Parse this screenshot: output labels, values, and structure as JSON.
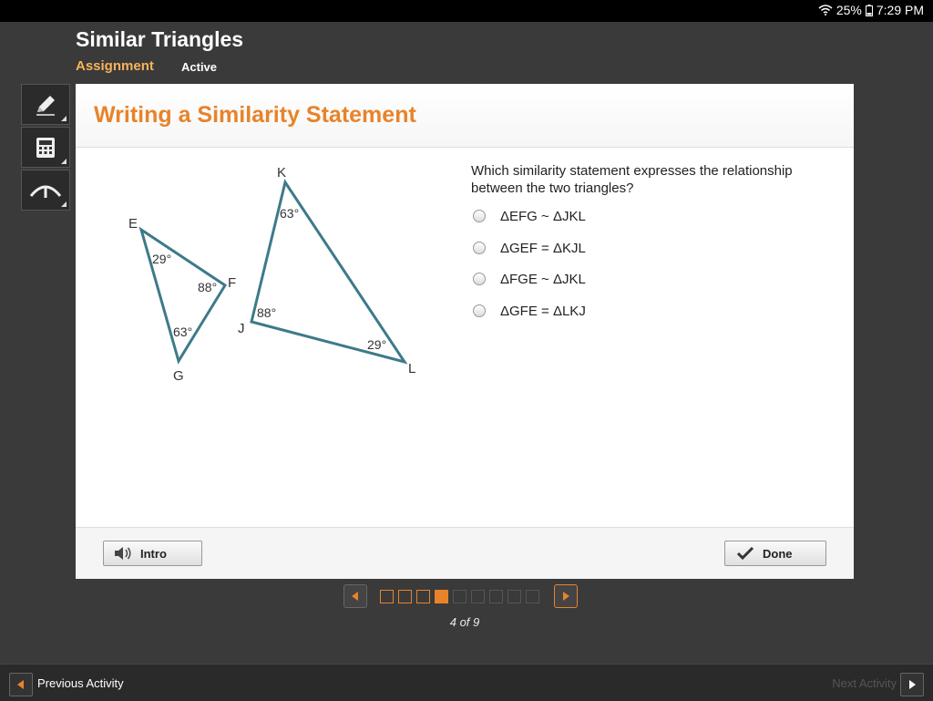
{
  "status": {
    "battery": "25%",
    "time": "7:29 PM"
  },
  "header": {
    "title": "Similar Triangles",
    "subtitle": "Assignment",
    "state": "Active"
  },
  "tools": [
    "pencil-icon",
    "calculator-icon",
    "reference-icon"
  ],
  "panel": {
    "title": "Writing a Similarity Statement"
  },
  "figure": {
    "triangle1": {
      "vertices": [
        "E",
        "F",
        "G"
      ],
      "angles": [
        "29°",
        "88°",
        "63°"
      ]
    },
    "triangle2": {
      "vertices": [
        "K",
        "J",
        "L"
      ],
      "angles": [
        "63°",
        "88°",
        "29°"
      ]
    }
  },
  "question": "Which similarity statement expresses the relationship between the two triangles?",
  "options": [
    "ΔEFG ~ ΔJKL",
    "ΔGEF = ΔKJL",
    "ΔFGE ~ ΔJKL",
    "ΔGFE = ΔLKJ"
  ],
  "footer": {
    "intro": "Intro",
    "done": "Done"
  },
  "pager": {
    "count": "4 of 9",
    "total": 9,
    "current": 4
  },
  "nav": {
    "previous": "Previous Activity",
    "next": "Next Activity"
  },
  "colors": {
    "accent": "#e8832a",
    "triangle": "#3d7a8a"
  }
}
